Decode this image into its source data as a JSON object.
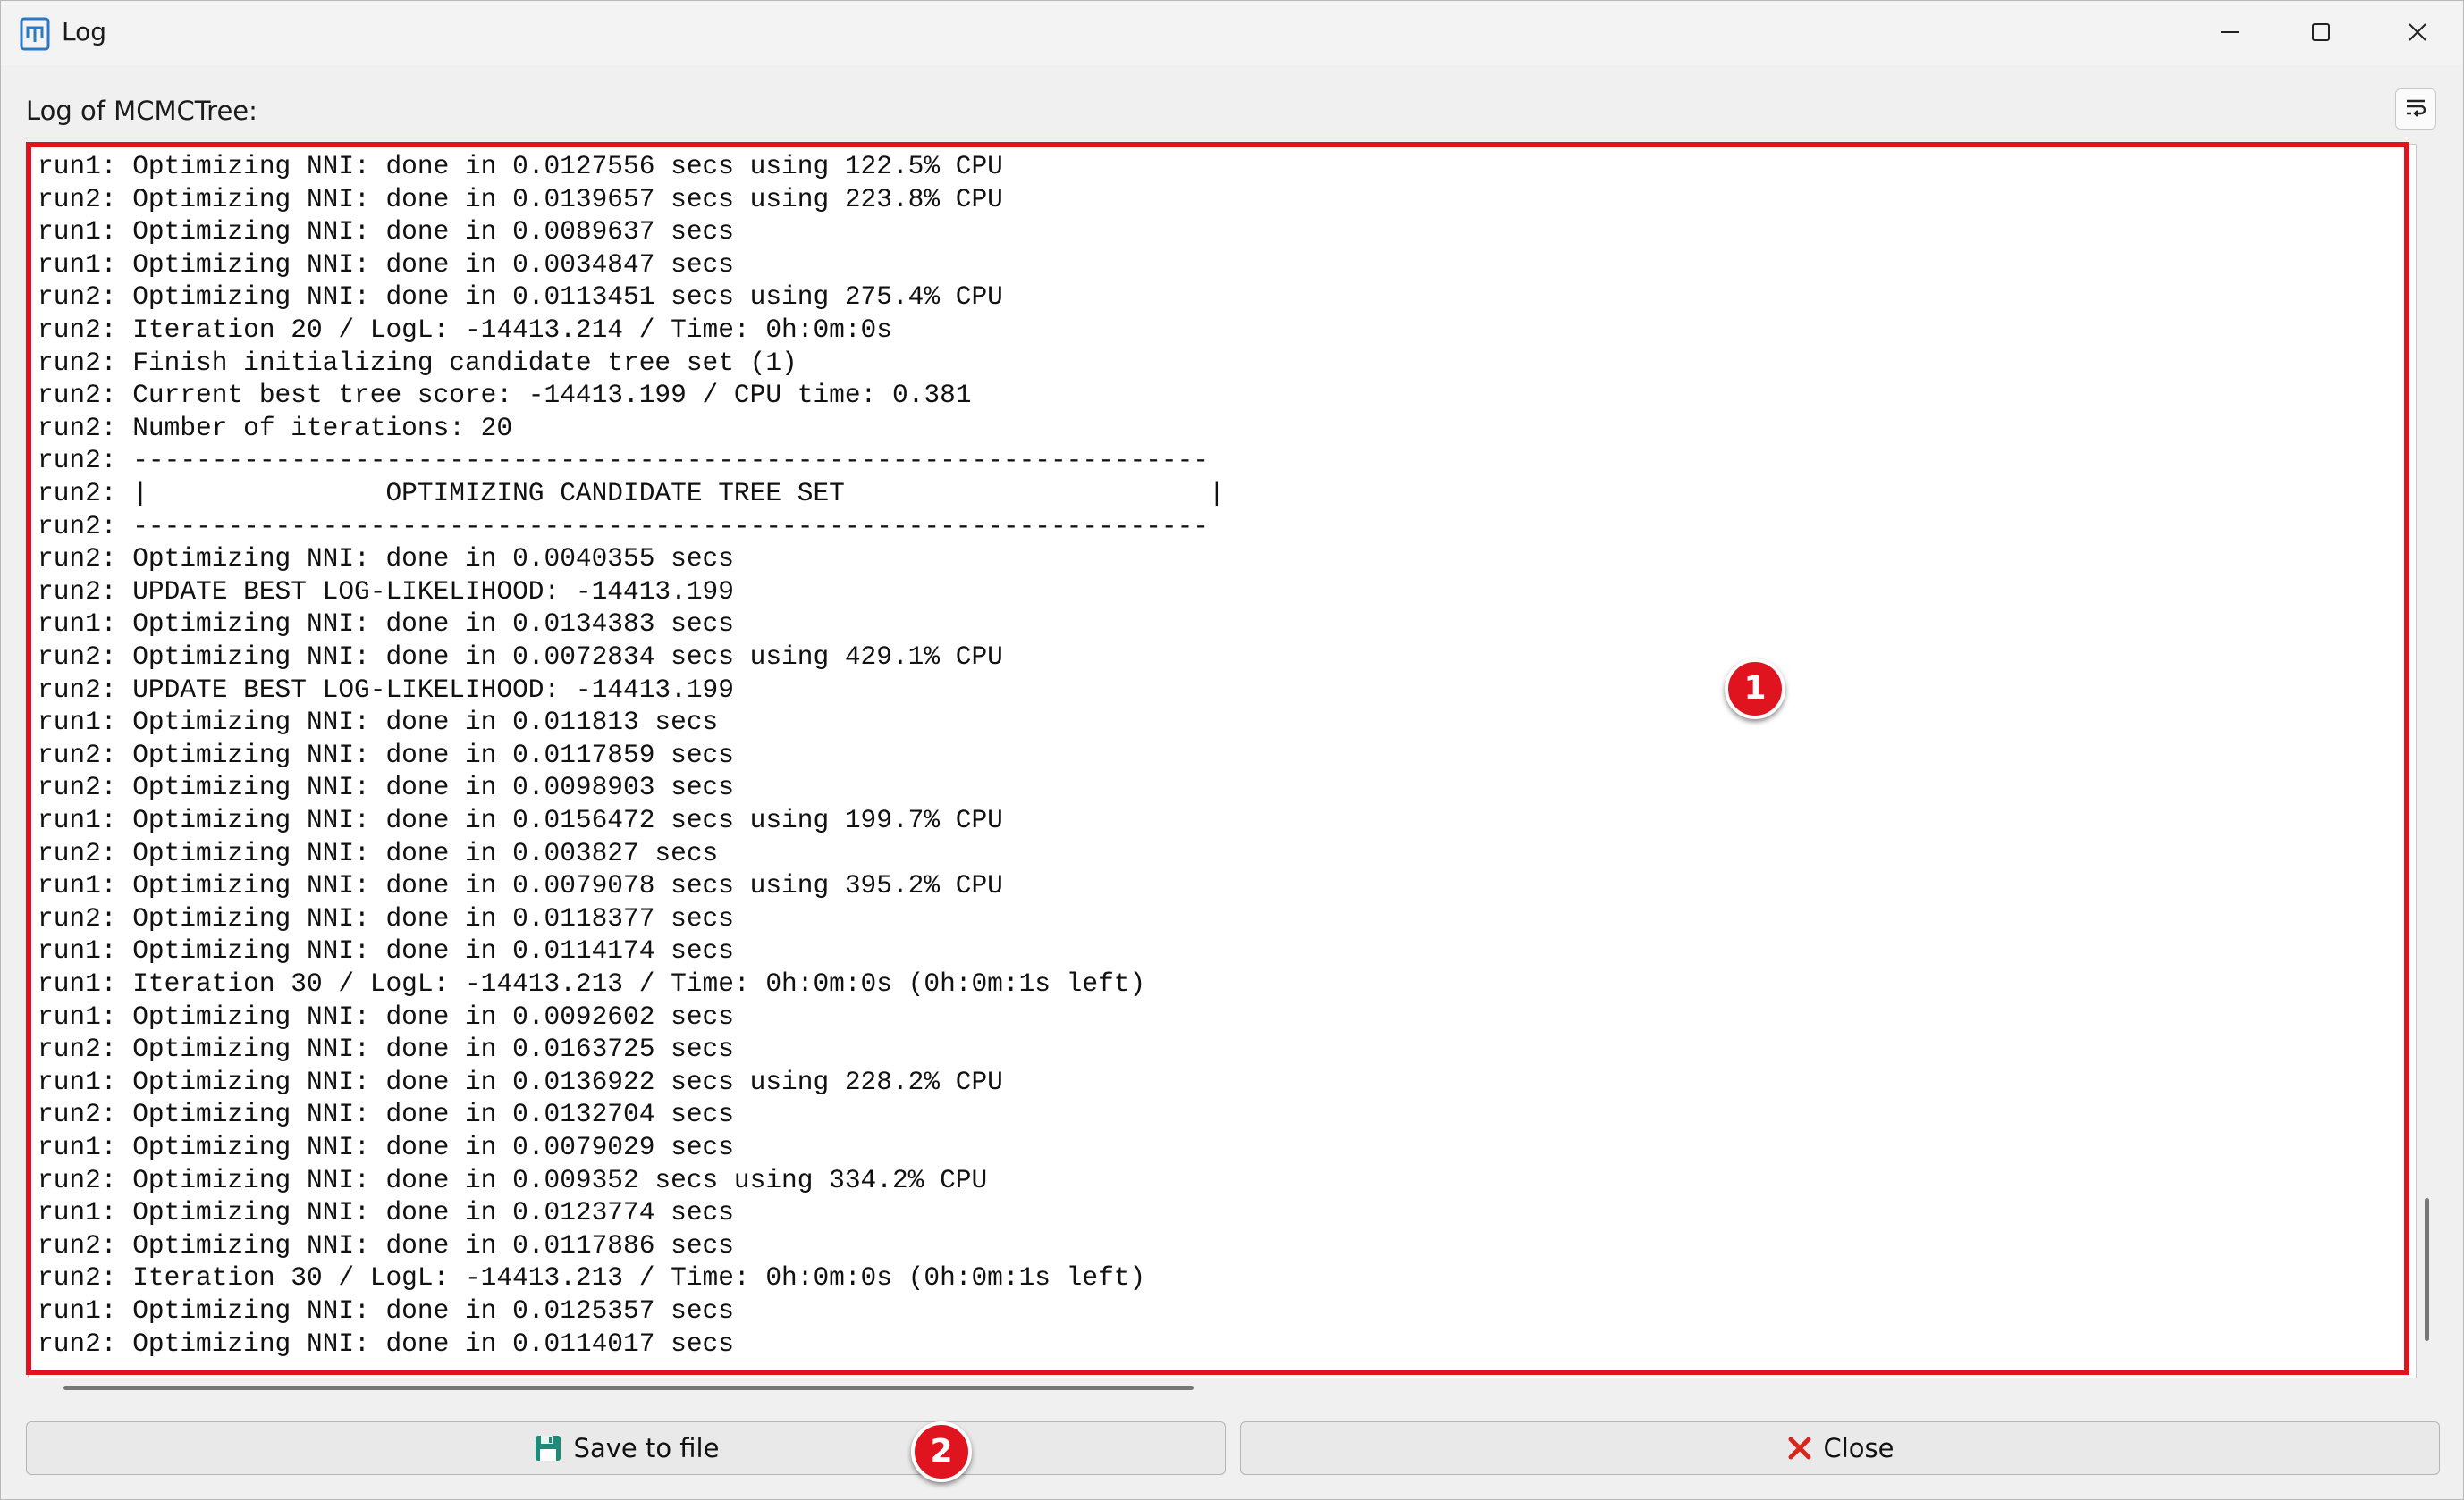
{
  "window": {
    "title": "Log",
    "controls": {
      "minimize": "minimize-icon",
      "maximize": "maximize-icon",
      "close": "close-icon"
    }
  },
  "header": {
    "label": "Log of MCMCTree:",
    "wrap_toggle_icon": "word-wrap-icon"
  },
  "log": {
    "lines": [
      "run1: Optimizing NNI: done in 0.0127556 secs using 122.5% CPU",
      "run2: Optimizing NNI: done in 0.0139657 secs using 223.8% CPU",
      "run1: Optimizing NNI: done in 0.0089637 secs",
      "run1: Optimizing NNI: done in 0.0034847 secs",
      "run2: Optimizing NNI: done in 0.0113451 secs using 275.4% CPU",
      "run2: Iteration 20 / LogL: -14413.214 / Time: 0h:0m:0s",
      "run2: Finish initializing candidate tree set (1)",
      "run2: Current best tree score: -14413.199 / CPU time: 0.381",
      "run2: Number of iterations: 20",
      "run2: --------------------------------------------------------------------",
      "run2: |               OPTIMIZING CANDIDATE TREE SET                       |",
      "run2: --------------------------------------------------------------------",
      "run2: Optimizing NNI: done in 0.0040355 secs",
      "run2: UPDATE BEST LOG-LIKELIHOOD: -14413.199",
      "run1: Optimizing NNI: done in 0.0134383 secs",
      "run2: Optimizing NNI: done in 0.0072834 secs using 429.1% CPU",
      "run2: UPDATE BEST LOG-LIKELIHOOD: -14413.199",
      "run1: Optimizing NNI: done in 0.011813 secs",
      "run2: Optimizing NNI: done in 0.0117859 secs",
      "run2: Optimizing NNI: done in 0.0098903 secs",
      "run1: Optimizing NNI: done in 0.0156472 secs using 199.7% CPU",
      "run2: Optimizing NNI: done in 0.003827 secs",
      "run1: Optimizing NNI: done in 0.0079078 secs using 395.2% CPU",
      "run2: Optimizing NNI: done in 0.0118377 secs",
      "run1: Optimizing NNI: done in 0.0114174 secs",
      "run1: Iteration 30 / LogL: -14413.213 / Time: 0h:0m:0s (0h:0m:1s left)",
      "run1: Optimizing NNI: done in 0.0092602 secs",
      "run2: Optimizing NNI: done in 0.0163725 secs",
      "run1: Optimizing NNI: done in 0.0136922 secs using 228.2% CPU",
      "run2: Optimizing NNI: done in 0.0132704 secs",
      "run1: Optimizing NNI: done in 0.0079029 secs",
      "run2: Optimizing NNI: done in 0.009352 secs using 334.2% CPU",
      "run1: Optimizing NNI: done in 0.0123774 secs",
      "run2: Optimizing NNI: done in 0.0117886 secs",
      "run2: Iteration 30 / LogL: -14413.213 / Time: 0h:0m:0s (0h:0m:1s left)",
      "run1: Optimizing NNI: done in 0.0125357 secs",
      "run2: Optimizing NNI: done in 0.0114017 secs"
    ]
  },
  "callouts": {
    "one": "1",
    "two": "2"
  },
  "buttons": {
    "save_label": "Save to file",
    "save_icon": "save-disk-icon",
    "close_label": "Close",
    "close_icon": "red-x-icon"
  },
  "colors": {
    "highlight": "#e0141e",
    "badge": "#e0141e",
    "close_icon": "#d9261c",
    "save_icon": "#1e8b7a"
  }
}
